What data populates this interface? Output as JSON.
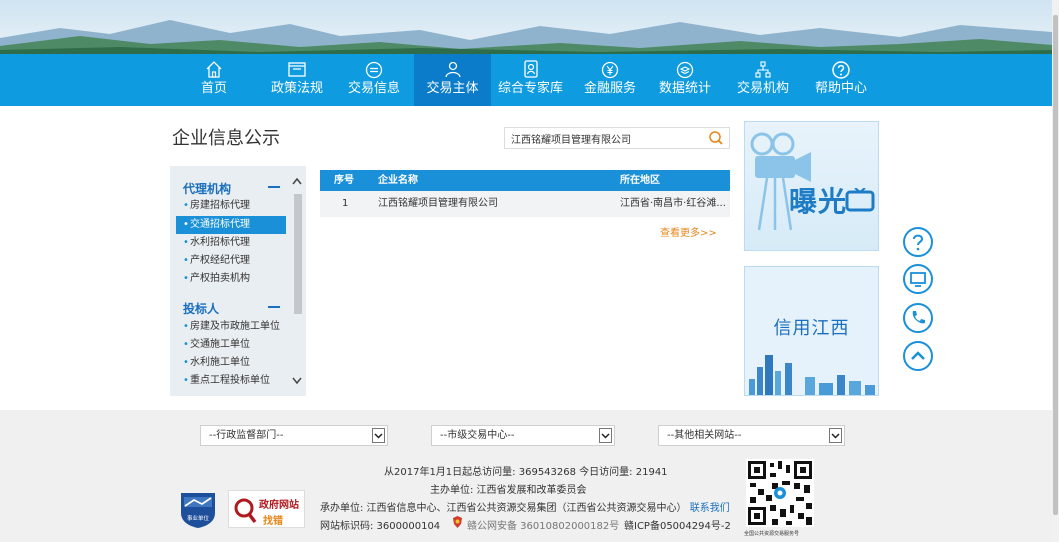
{
  "nav": {
    "items": [
      {
        "label": "首页",
        "icon": "home-icon"
      },
      {
        "label": "政策法规",
        "icon": "folder-icon"
      },
      {
        "label": "交易信息",
        "icon": "list-circle-icon"
      },
      {
        "label": "交易主体",
        "icon": "user-icon",
        "active": true
      },
      {
        "label": "综合专家库",
        "icon": "expert-icon"
      },
      {
        "label": "金融服务",
        "icon": "yuan-icon"
      },
      {
        "label": "数据统计",
        "icon": "data-icon"
      },
      {
        "label": "交易机构",
        "icon": "org-chart-icon"
      },
      {
        "label": "帮助中心",
        "icon": "help-icon"
      }
    ]
  },
  "page": {
    "title": "企业信息公示"
  },
  "search": {
    "value": "江西铭耀项目管理有限公司",
    "icon": "search-icon"
  },
  "sidebar": {
    "groups": [
      {
        "title": "代理机构",
        "items": [
          "房建招标代理",
          "交通招标代理",
          "水利招标代理",
          "产权经纪代理",
          "产权拍卖机构"
        ],
        "active_index": 1
      },
      {
        "title": "投标人",
        "items": [
          "房建及市政施工单位",
          "交通施工单位",
          "水利施工单位",
          "重点工程投标单位"
        ]
      }
    ]
  },
  "table": {
    "headers": [
      "序号",
      "企业名称",
      "所在地区"
    ],
    "rows": [
      [
        "1",
        "江西铭耀项目管理有限公司",
        "江西省·南昌市·红谷滩..."
      ]
    ],
    "more": "查看更多>>"
  },
  "ads": {
    "ad1_text": "曝光",
    "ad2_text": "信用江西"
  },
  "floating": [
    "help-icon",
    "monitor-icon",
    "phone-icon",
    "up-icon"
  ],
  "footer": {
    "selects": [
      "--行政监督部门--",
      "--市级交易中心--",
      "--其他相关网站--"
    ],
    "visits_prefix": "从2017年1月1日起总访问量: ",
    "visits_total": "369543268",
    "visits_today_label": " 今日访问量: ",
    "visits_today": "21941",
    "host": "主办单位: 江西省发展和改革委员会",
    "undertaker": "承办单位: 江西省信息中心、江西省公共资源交易集团（江西省公共资源交易中心）",
    "contact": "联系我们",
    "site_id": "网站标识码: 3600000104",
    "police": "赣公网安备 36010802000182号",
    "icp": "赣ICP备05004294号-2",
    "gov_line1": "政府网站",
    "gov_line2": "找错",
    "badge_text": "事业单位",
    "qr_caption": "全国公共资源交易服务号"
  },
  "colors": {
    "nav": "#0f9be0",
    "nav_active": "#0b7cc9",
    "accent": "#1a90d9",
    "more": "#e8851a"
  }
}
